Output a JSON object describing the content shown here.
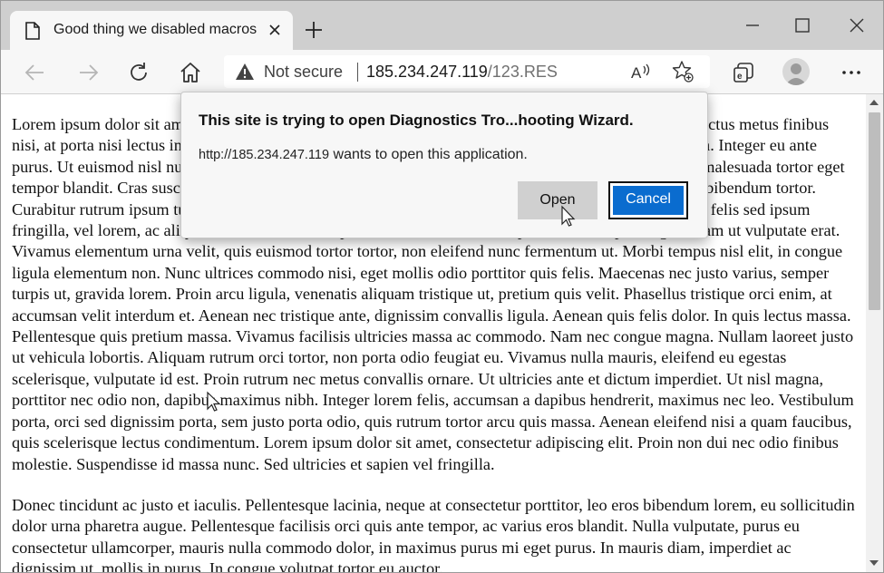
{
  "tab": {
    "title": "Good thing we disabled macros"
  },
  "address": {
    "security_label": "Not secure",
    "host": "185.234.247.119",
    "path": "/123.RES"
  },
  "icons": {
    "tab": "page-icon",
    "tab_close": "close-icon",
    "new_tab": "plus-icon",
    "minimize": "minimize-icon",
    "maximize": "maximize-icon",
    "close": "close-icon",
    "back": "back-arrow-icon",
    "forward": "forward-arrow-icon",
    "refresh": "refresh-icon",
    "home": "home-icon",
    "warning": "warning-icon",
    "read_aloud": "read-aloud-icon",
    "favorites": "favorites-add-icon",
    "collections": "collections-icon",
    "profile": "profile-avatar",
    "menu": "more-menu-icon"
  },
  "dialog": {
    "title": "This site is trying to open Diagnostics Tro...hooting Wizard.",
    "url": "http://185.234.247.119",
    "message": "wants to open this application.",
    "open_label": "Open",
    "cancel_label": "Cancel"
  },
  "content": {
    "paragraphs": [
      "Lorem ipsum dolor sit amet, consectetur adipiscing elit. Nunc lacinia, lorem sit amet tincidunt tempus, lectus metus finibus nisi, at porta nisi lectus in dignissim. Nam id mauris lorem. Nunc dapibus quam non tincidunt fermentum. Integer eu ante purus. Ut euismod nisl nulla, vel semper lectus feugiat in. Donec vitae sapien bibendum eu. Vestibulum malesuada tortor eget tempor blandit. Cras suscipit nulla a ante rutrum, et sodales ex semper. Praesent ipsum mi, volutpat quis bibendum tortor. Curabitur rutrum ipsum turpis, id suscipit quam tristique et. Mauris posuere egestas sem. Integer suscipit felis sed ipsum fringilla, vel lorem, ac aliquet risus. Aenean eu sapien tincidunt, hendrerit sapien sed, volutpat magna. Nam ut vulputate erat. Vivamus elementum urna velit, quis euismod tortor tortor, non eleifend nunc fermentum ut. Morbi tempus nisl elit, in congue ligula elementum non. Nunc ultrices commodo nisi, eget mollis odio porttitor quis felis. Maecenas nec justo varius, semper turpis ut, gravida lorem. Proin arcu ligula, venenatis aliquam tristique ut, pretium quis velit. Phasellus tristique orci enim, at accumsan velit interdum et. Aenean nec tristique ante, dignissim convallis ligula. Aenean quis felis dolor. In quis lectus massa. Pellentesque quis pretium massa. Vivamus facilisis ultricies massa ac commodo. Nam nec congue magna. Nullam laoreet justo ut vehicula lobortis. Aliquam rutrum orci tortor, non porta odio feugiat eu. Vivamus nulla mauris, eleifend eu egestas scelerisque, vulputate id est. Proin rutrum nec metus convallis ornare. Ut ultricies ante et dictum imperdiet. Ut nisl magna, porttitor nec odio non, dapibus maximus nibh. Integer lorem felis, accumsan a dapibus hendrerit, maximus nec leo. Vestibulum porta, orci sed dignissim porta, sem justo porta odio, quis rutrum tortor arcu quis massa. Aenean eleifend nisi a quam faucibus, quis scelerisque lectus condimentum. Lorem ipsum dolor sit amet, consectetur adipiscing elit. Proin non dui nec odio finibus molestie. Suspendisse id massa nunc. Sed ultricies et sapien vel fringilla.",
      "Donec tincidunt ac justo et iaculis. Pellentesque lacinia, neque at consectetur porttitor, leo eros bibendum lorem, eu sollicitudin dolor urna pharetra augue. Pellentesque facilisis orci quis ante tempor, ac varius eros blandit. Nulla vulputate, purus eu consectetur ullamcorper, mauris nulla commodo dolor, in maximus purus mi eget purus. In mauris diam, imperdiet ac dignissim ut, mollis in purus. In congue volutpat tortor eu auctor."
    ]
  }
}
